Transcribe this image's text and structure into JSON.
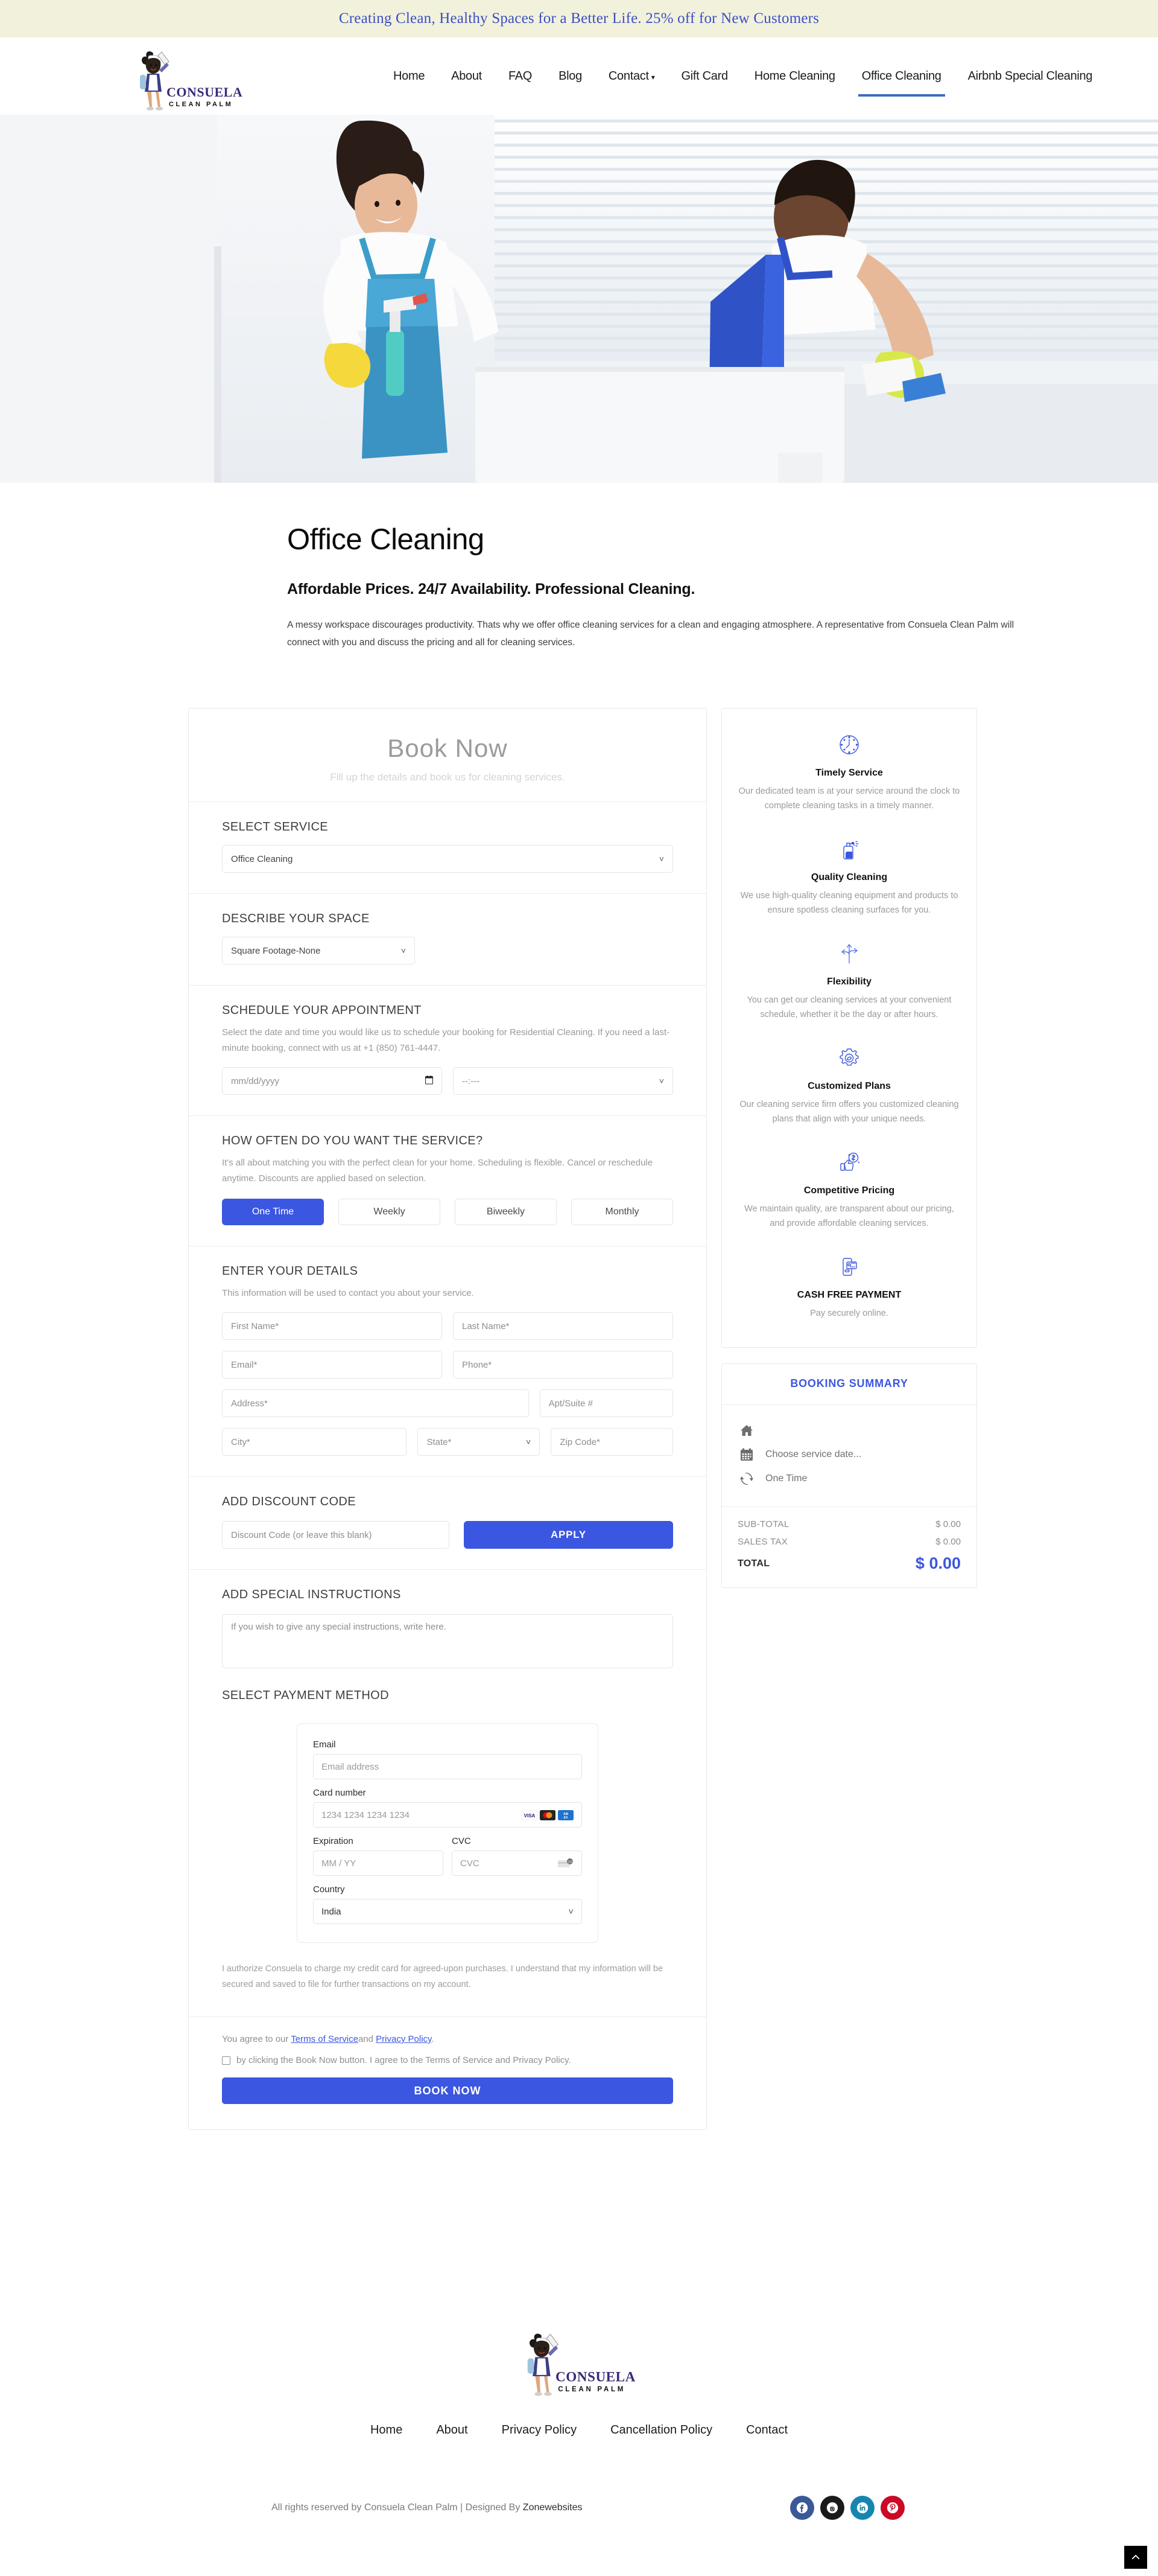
{
  "banner": {
    "text": "Creating Clean, Healthy Spaces for a Better Life. 25% off for New Customers"
  },
  "brand": {
    "name": "CONSUELA",
    "tagline": "CLEAN PALM"
  },
  "nav": {
    "items": [
      {
        "label": "Home",
        "active": false
      },
      {
        "label": "About",
        "active": false
      },
      {
        "label": "FAQ",
        "active": false
      },
      {
        "label": "Blog",
        "active": false
      },
      {
        "label": "Contact",
        "active": false,
        "caret": "▾"
      },
      {
        "label": "Gift Card",
        "active": false
      },
      {
        "label": "Home Cleaning",
        "active": false
      },
      {
        "label": "Office Cleaning",
        "active": true
      },
      {
        "label": "Airbnb Special Cleaning",
        "active": false
      }
    ]
  },
  "intro": {
    "title": "Office Cleaning",
    "subtitle": "Affordable Prices. 24/7 Availability. Professional Cleaning.",
    "description": "A messy workspace discourages productivity. Thats why we offer office cleaning services for a clean and engaging atmosphere. A representative from Consuela Clean Palm will connect with you and discuss the pricing and all for cleaning services."
  },
  "booking": {
    "title": "Book Now",
    "subtitle": "Fill up the details and book us for cleaning services.",
    "select_service": {
      "label": "SELECT SERVICE",
      "value": "Office Cleaning"
    },
    "describe_space": {
      "label": "DESCRIBE YOUR SPACE",
      "value": "Square Footage-None"
    },
    "schedule": {
      "label": "SCHEDULE YOUR APPOINTMENT",
      "help": "Select the date and time you would like us to schedule your booking for Residential Cleaning. If you need a last-minute booking, connect with us at +1 (850) 761-4447.",
      "date_placeholder": "mm/dd/yyyy",
      "time_placeholder": "--:---"
    },
    "frequency": {
      "label": "HOW OFTEN DO YOU WANT THE SERVICE?",
      "help": "It's all about matching you with the perfect clean for your home. Scheduling is flexible. Cancel or reschedule anytime. Discounts are applied based on selection.",
      "options": [
        "One Time",
        "Weekly",
        "Biweekly",
        "Monthly"
      ],
      "selected": "One Time"
    },
    "details": {
      "label": "ENTER YOUR DETAILS",
      "help": "This information will be used to contact you about your service.",
      "first_name": "First Name*",
      "last_name": "Last Name*",
      "email": "Email*",
      "phone": "Phone*",
      "address": "Address*",
      "apt": "Apt/Suite #",
      "city": "City*",
      "state": "State*",
      "zip": "Zip Code*"
    },
    "discount": {
      "label": "ADD DISCOUNT CODE",
      "placeholder": "Discount Code (or leave this blank)",
      "apply": "APPLY"
    },
    "instructions": {
      "label": "ADD SPECIAL INSTRUCTIONS",
      "placeholder": "If you wish to give any special instructions, write here."
    },
    "payment": {
      "label": "SELECT PAYMENT METHOD",
      "email_label": "Email",
      "email_placeholder": "Email address",
      "card_label": "Card number",
      "card_placeholder": "1234 1234 1234 1234",
      "exp_label": "Expiration",
      "exp_placeholder": "MM / YY",
      "cvc_label": "CVC",
      "cvc_placeholder": "CVC",
      "country_label": "Country",
      "country_value": "India",
      "brands": [
        "VISA",
        "Mastercard",
        "AMEX"
      ]
    },
    "authorization": "I authorize Consuela to charge my credit card for agreed-upon purchases. I understand that my information will be secured and saved to file for further transactions on my account.",
    "terms": {
      "prefix": "You agree to our ",
      "tos": "Terms of Service",
      "mid": "and ",
      "privacy": "Privacy Policy",
      "suffix": ".",
      "checkbox_text": "by clicking the Book Now button. I agree to the Terms of Service and Privacy Policy.",
      "checked": false
    },
    "book_button": "BOOK NOW"
  },
  "features": [
    {
      "icon": "clock-icon",
      "title": "Timely Service",
      "desc": "Our dedicated team is at your service around the clock to complete cleaning tasks in a timely manner."
    },
    {
      "icon": "spray-bottle-icon",
      "title": "Quality Cleaning",
      "desc": "We use high-quality cleaning equipment and products to ensure spotless cleaning surfaces for you."
    },
    {
      "icon": "arrows-direction-icon",
      "title": "Flexibility",
      "desc": "You can get our cleaning services at your convenient schedule, whether it be the day or after hours."
    },
    {
      "icon": "gear-icon",
      "title": "Customized Plans",
      "desc": "Our cleaning service firm offers you customized cleaning plans that align with your unique needs."
    },
    {
      "icon": "thumbs-up-dollar-icon",
      "title": "Competitive Pricing",
      "desc": "We maintain quality, are transparent about our pricing, and provide affordable cleaning services."
    },
    {
      "icon": "mobile-pay-icon",
      "title": "CASH FREE PAYMENT",
      "desc": "Pay securely online."
    }
  ],
  "summary": {
    "title": "BOOKING SUMMARY",
    "lines": [
      {
        "icon": "home-icon",
        "value": ""
      },
      {
        "icon": "calendar-icon",
        "value": "Choose service date..."
      },
      {
        "icon": "refresh-icon",
        "value": "One Time"
      }
    ],
    "subtotal_label": "SUB-TOTAL",
    "subtotal_value": "$ 0.00",
    "tax_label": "SALES TAX",
    "tax_value": "$ 0.00",
    "total_label": "TOTAL",
    "total_value": "$ 0.00"
  },
  "footer": {
    "nav": [
      "Home",
      "About",
      "Privacy Policy",
      "Cancellation Policy",
      "Contact"
    ],
    "copyright_main": "All rights reserved by Consuela Clean Palm | Designed By ",
    "copyright_brand": "Zonewebsites",
    "socials": [
      "facebook-icon",
      "instagram-icon",
      "linkedin-icon",
      "pinterest-icon"
    ]
  },
  "colors": {
    "accent_blue": "#3b56e0",
    "banner_bg": "#f2f2dc",
    "banner_text": "#3b4ec6",
    "nav_underline": "#3b6bbf"
  }
}
